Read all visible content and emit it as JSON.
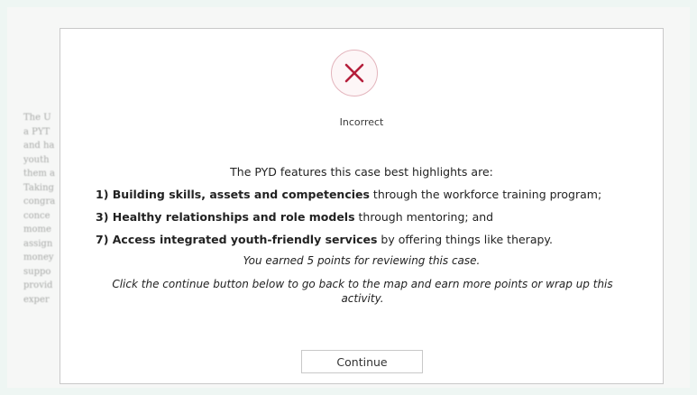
{
  "background_text": {
    "lines": [
      "The U",
      "a PYT",
      "and ha",
      "youth",
      "them a",
      "Taking",
      "congra",
      "conce",
      "mome",
      "assign",
      "money",
      "suppo",
      "provid",
      "exper"
    ]
  },
  "dialog": {
    "icon": "close-x-icon",
    "icon_color": "#b51f3b",
    "result_label": "Incorrect",
    "heading": "The PYD features this case best highlights are:",
    "features": [
      {
        "bold": "1) Building skills, assets and competencies",
        "rest": " through the workforce training program;"
      },
      {
        "bold": "3) Healthy relationships and role models",
        "rest": " through mentoring; and"
      },
      {
        "bold": "7) Access integrated youth-friendly services",
        "rest": " by offering things like therapy."
      }
    ],
    "points_text": "You earned 5 points for reviewing this case.",
    "instruction_text": "Click the continue button below to go back to the map and earn more points or wrap up this activity.",
    "continue_label": "Continue"
  }
}
